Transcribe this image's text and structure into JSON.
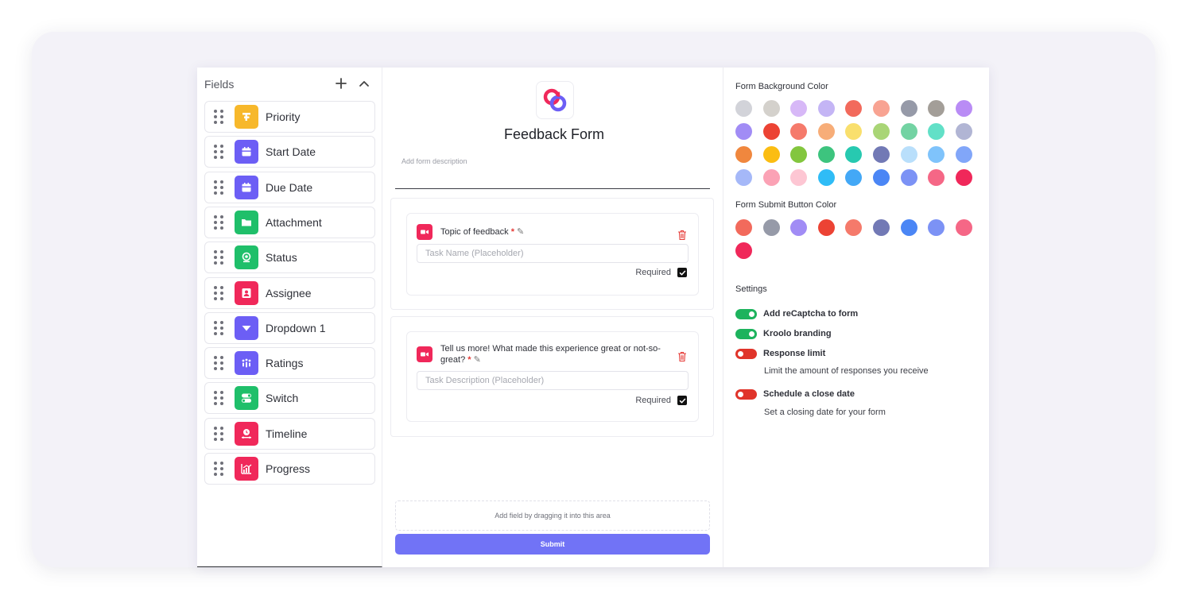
{
  "fields": {
    "title": "Fields",
    "items": [
      {
        "label": "Priority",
        "color": "#f7b82b",
        "icon": "priority-icon"
      },
      {
        "label": "Start Date",
        "color": "#6c5ef5",
        "icon": "calendar-icon"
      },
      {
        "label": "Due Date",
        "color": "#6c5ef5",
        "icon": "calendar-icon"
      },
      {
        "label": "Attachment",
        "color": "#1fbf6a",
        "icon": "folder-icon"
      },
      {
        "label": "Status",
        "color": "#1fbf6a",
        "icon": "status-icon"
      },
      {
        "label": "Assignee",
        "color": "#f0285a",
        "icon": "user-icon"
      },
      {
        "label": "Dropdown 1",
        "color": "#6c5ef5",
        "icon": "dropdown-icon"
      },
      {
        "label": "Ratings",
        "color": "#6c5ef5",
        "icon": "ratings-icon"
      },
      {
        "label": "Switch",
        "color": "#1fbf6a",
        "icon": "switch-icon"
      },
      {
        "label": "Timeline",
        "color": "#f0285a",
        "icon": "timeline-icon"
      },
      {
        "label": "Progress",
        "color": "#f0285a",
        "icon": "progress-icon"
      }
    ]
  },
  "form": {
    "title": "Feedback Form",
    "description_placeholder": "Add form description",
    "questions": [
      {
        "label": "Topic of feedback",
        "placeholder": "Task Name (Placeholder)",
        "required_label": "Required"
      },
      {
        "label_line1": "Tell us more! What made this experience great or not-so-",
        "label_line2": "great?",
        "placeholder": "Task Description (Placeholder)",
        "required_label": "Required"
      }
    ],
    "drop_hint": "Add field by dragging it into this area",
    "submit_label": "Submit"
  },
  "settings": {
    "bg_title": "Form Background Color",
    "bg_colors": [
      "#d2d3d9",
      "#d4d1cc",
      "#d7b8f7",
      "#c4b5f5",
      "#f26a5c",
      "#f8a392",
      "#969aa8",
      "#a39e98",
      "#b98cf5",
      "#a18cf5",
      "#ec4334",
      "#f57a6b",
      "#f7ad78",
      "#f9df6d",
      "#a9d576",
      "#73d3a3",
      "#62e0c7",
      "#b1b5d4",
      "#f0873e",
      "#fbbd12",
      "#83c63e",
      "#3dc47e",
      "#27c9b0",
      "#7279b5",
      "#b9dffb",
      "#7fc3fb",
      "#81a6f9",
      "#a5b8f8",
      "#fba2b5",
      "#fdc6d3",
      "#2fbcf6",
      "#43a8f6",
      "#4b86f5",
      "#7c92f5",
      "#f56786",
      "#f0285a"
    ],
    "submit_title": "Form Submit Button Color",
    "submit_colors": [
      "#f26a5c",
      "#969aa8",
      "#a18cf5",
      "#ec4334",
      "#f57a6b",
      "#7279b5",
      "#4b86f5",
      "#7c92f5",
      "#f56786",
      "#f0285a"
    ],
    "settings_title": "Settings",
    "toggles": [
      {
        "label": "Add reCaptcha to form",
        "on": true
      },
      {
        "label": "Kroolo branding",
        "on": true
      },
      {
        "label": "Response limit",
        "on": false,
        "sub": "Limit the amount of responses you receive"
      },
      {
        "label": "Schedule a close date",
        "on": false,
        "sub": "Set a closing date for your form"
      }
    ]
  }
}
